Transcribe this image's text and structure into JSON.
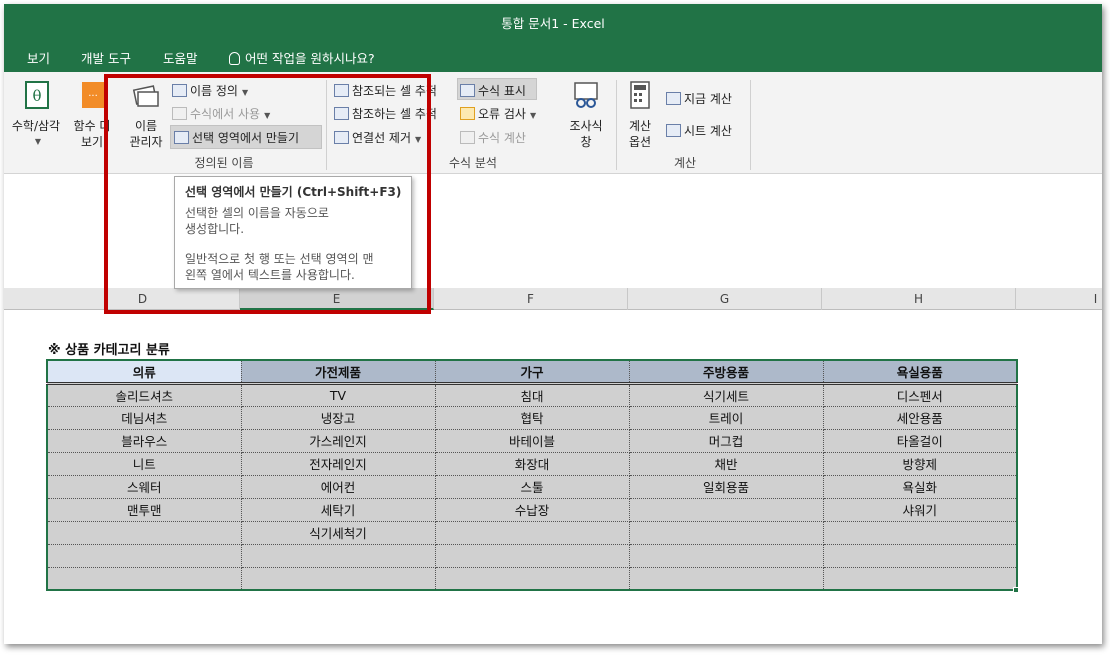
{
  "app": {
    "title": "통합 문서1  -  Excel"
  },
  "menu": [
    "보기",
    "개발 도구",
    "도움말"
  ],
  "tell_me": "어떤 작업을 원하시나요?",
  "ribbon": {
    "math_trig": "수학/삼각",
    "more_functions": [
      "함수 더",
      "보기"
    ],
    "name_manager": [
      "이름",
      "관리자"
    ],
    "define_name": "이름 정의",
    "use_in_formula": "수식에서 사용",
    "create_from_selection": "선택 영역에서 만들기",
    "defined_names_group": "정의된 이름",
    "trace_precedents": "참조되는 셀 추적",
    "trace_dependents": "참조하는 셀 추적",
    "remove_arrows": "연결선 제거",
    "show_formulas": "수식 표시",
    "error_checking": "오류 검사",
    "evaluate_formula": "수식 계산",
    "watch_window": [
      "조사식",
      "창"
    ],
    "formula_auditing_group": "수식 분석",
    "calc_options": [
      "계산",
      "옵션"
    ],
    "calc_now": "지금 계산",
    "calc_sheet": "시트 계산",
    "calculation_group": "계산"
  },
  "tooltip": {
    "title": "선택 영역에서 만들기 (Ctrl+Shift+F3)",
    "line1": "선택한 셀의 이름을 자동으로",
    "line2": "생성합니다.",
    "line3": "일반적으로 첫 행 또는 선택 영역의 맨",
    "line4": "왼쪽 열에서 텍스트를 사용합니다."
  },
  "columns": [
    "D",
    "E",
    "F",
    "G",
    "H",
    "I"
  ],
  "sheet": {
    "heading": "※ 상품 카테고리 분류",
    "headers": [
      "의류",
      "가전제품",
      "가구",
      "주방용품",
      "욕실용품"
    ],
    "rows": [
      [
        "솔리드셔츠",
        "TV",
        "침대",
        "식기세트",
        "디스펜서"
      ],
      [
        "데님셔츠",
        "냉장고",
        "협탁",
        "트레이",
        "세안용품"
      ],
      [
        "블라우스",
        "가스레인지",
        "바테이블",
        "머그컵",
        "타올걸이"
      ],
      [
        "니트",
        "전자레인지",
        "화장대",
        "채반",
        "방향제"
      ],
      [
        "스웨터",
        "에어컨",
        "스툴",
        "일회용품",
        "욕실화"
      ],
      [
        "맨투맨",
        "세탁기",
        "수납장",
        "",
        "샤워기"
      ],
      [
        "",
        "식기세척기",
        "",
        "",
        ""
      ],
      [
        "",
        "",
        "",
        "",
        ""
      ],
      [
        "",
        "",
        "",
        "",
        ""
      ]
    ]
  },
  "colors": {
    "excel_green": "#217346",
    "highlight_red": "#c00000",
    "header_fill": "#adb9ca",
    "cell_fill": "#d0d0d0"
  }
}
